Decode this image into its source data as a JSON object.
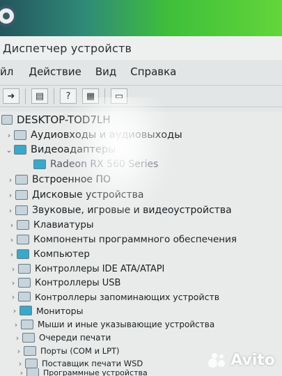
{
  "window": {
    "title": "Диспетчер устройств"
  },
  "menu": {
    "items": [
      "йл",
      "Действие",
      "Вид",
      "Справка"
    ]
  },
  "toolbar": {
    "buttons": [
      "arrow-right-icon",
      "properties-icon",
      "help-icon",
      "panel-icon",
      "monitor-icon"
    ]
  },
  "tree": {
    "root": "DESKTOP-TOD7LH",
    "items": [
      {
        "label": "Аудиовходы и аудиовыходы",
        "icon": "speaker-icon",
        "expanded": false
      },
      {
        "label": "Видеоадаптеры",
        "icon": "display-adapter-icon",
        "expanded": true,
        "children": [
          "Radeon RX 560 Series"
        ]
      },
      {
        "label": "Встроенное ПО",
        "icon": "firmware-icon",
        "expanded": false
      },
      {
        "label": "Дисковые устройства",
        "icon": "disk-icon",
        "expanded": false
      },
      {
        "label": "Звуковые, игровые и видеоустройства",
        "icon": "sound-icon",
        "expanded": false
      },
      {
        "label": "Клавиатуры",
        "icon": "keyboard-icon",
        "expanded": false
      },
      {
        "label": "Компоненты программного обеспечения",
        "icon": "software-icon",
        "expanded": false
      },
      {
        "label": "Компьютер",
        "icon": "computer-icon",
        "expanded": false
      },
      {
        "label": "Контроллеры IDE ATA/ATAPI",
        "icon": "ide-icon",
        "expanded": false
      },
      {
        "label": "Контроллеры USB",
        "icon": "usb-icon",
        "expanded": false
      },
      {
        "label": "Контроллеры запоминающих устройств",
        "icon": "storage-icon",
        "expanded": false
      },
      {
        "label": "Мониторы",
        "icon": "monitor-icon",
        "expanded": false
      },
      {
        "label": "Мыши и иные указывающие устройства",
        "icon": "mouse-icon",
        "expanded": false
      },
      {
        "label": "Очереди печати",
        "icon": "print-queue-icon",
        "expanded": false
      },
      {
        "label": "Порты (COM и LPT)",
        "icon": "ports-icon",
        "expanded": false
      },
      {
        "label": "Поставщик печати WSD",
        "icon": "wsd-icon",
        "expanded": false
      },
      {
        "label": "Программные устройства",
        "icon": "software-device-icon",
        "expanded": false
      }
    ]
  },
  "watermark": {
    "text": "Avito"
  },
  "colors": {
    "desktop_green": "#3fbf3a",
    "window_bg": "#e3e6e6"
  }
}
